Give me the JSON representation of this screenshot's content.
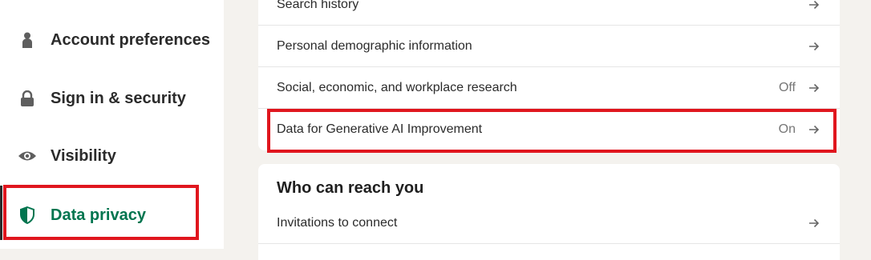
{
  "sidebar": {
    "items": [
      {
        "label": "Account preferences",
        "icon": "person-icon"
      },
      {
        "label": "Sign in & security",
        "icon": "lock-icon"
      },
      {
        "label": "Visibility",
        "icon": "eye-icon"
      },
      {
        "label": "Data privacy",
        "icon": "shield-icon",
        "active": true
      }
    ]
  },
  "data_settings": {
    "rows": [
      {
        "label": "Search history",
        "value": ""
      },
      {
        "label": "Personal demographic information",
        "value": ""
      },
      {
        "label": "Social, economic, and workplace research",
        "value": "Off"
      },
      {
        "label": "Data for Generative AI Improvement",
        "value": "On"
      }
    ]
  },
  "reach": {
    "title": "Who can reach you",
    "rows": [
      {
        "label": "Invitations to connect",
        "value": ""
      }
    ]
  },
  "colors": {
    "accent": "#01754f",
    "highlight": "#e0161e",
    "background": "#f4f2ee"
  }
}
